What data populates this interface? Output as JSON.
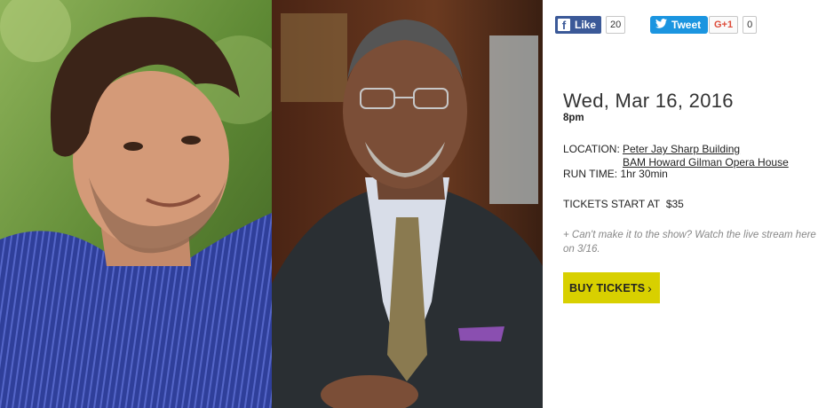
{
  "social": {
    "facebook": {
      "label": "Like",
      "count": "20"
    },
    "twitter": {
      "label": "Tweet"
    },
    "googleplus": {
      "label": "G+1",
      "count": "0"
    }
  },
  "event": {
    "date": "Wed, Mar 16, 2016",
    "time": "8pm",
    "location_label": "LOCATION:",
    "location_line1": "Peter Jay Sharp Building",
    "location_line2": "BAM Howard Gilman Opera House",
    "runtime_label": "RUN TIME:",
    "runtime": "1hr 30min",
    "tickets_label": "TICKETS START AT",
    "tickets_price": "$35",
    "stream_note": "+ Can't make it to the show? Watch the live stream here on 3/16.",
    "buy_label": "BUY TICKETS",
    "buy_chevron": "›"
  },
  "images": {
    "left": "portrait-man-blue-striped-shirt",
    "right": "portrait-man-suit-glasses"
  },
  "colors": {
    "facebook": "#3b5998",
    "twitter": "#1b95e0",
    "googleplus": "#dd4b39",
    "buy_button": "#d8d000"
  }
}
